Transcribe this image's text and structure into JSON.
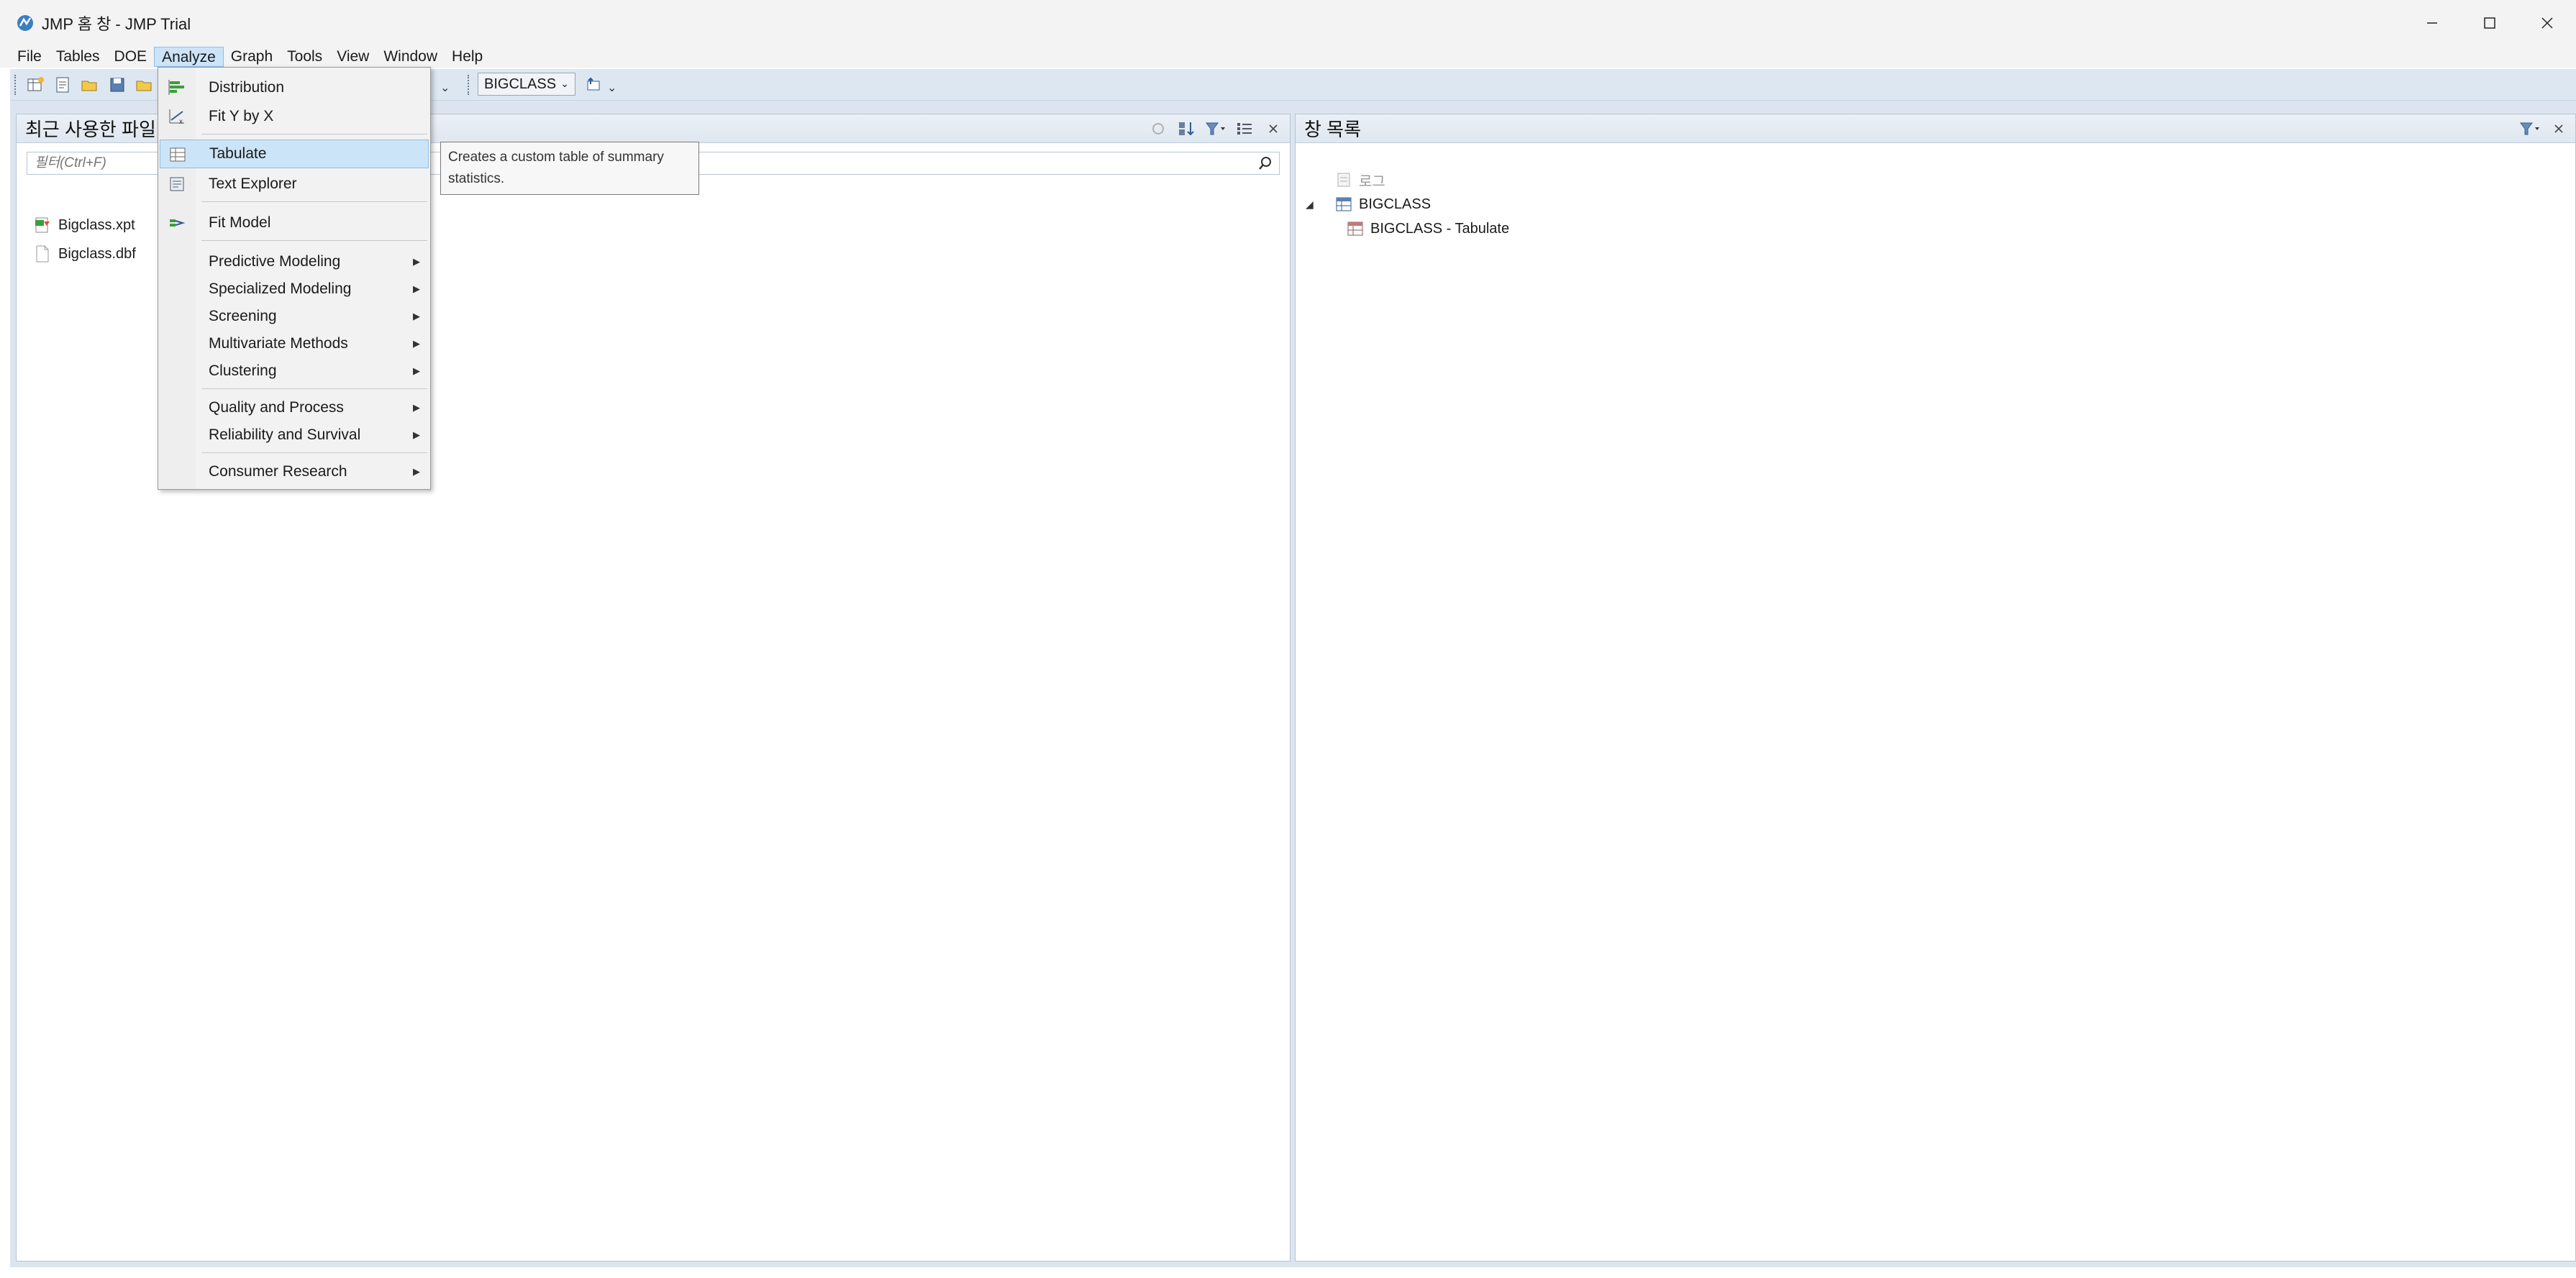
{
  "window": {
    "title": "JMP 홈 창 - JMP Trial",
    "controls": [
      "minimize-icon",
      "maximize-icon",
      "close-icon"
    ]
  },
  "menubar": {
    "items": [
      "File",
      "Tables",
      "DOE",
      "Analyze",
      "Graph",
      "Tools",
      "View",
      "Window",
      "Help"
    ],
    "active": "Analyze"
  },
  "toolbar": {
    "data_table_select": "BIGCLASS"
  },
  "analyze_menu": {
    "items": [
      {
        "label": "Distribution",
        "icon": "distribution-icon",
        "submenu": false
      },
      {
        "label": "Fit Y by X",
        "icon": "fit-y-by-x-icon",
        "submenu": false
      },
      {
        "label": "Tabulate",
        "icon": "tabulate-icon",
        "submenu": false,
        "highlighted": true
      },
      {
        "label": "Text Explorer",
        "icon": "text-explorer-icon",
        "submenu": false
      },
      {
        "label": "Fit Model",
        "icon": "fit-model-icon",
        "submenu": false
      },
      {
        "label": "Predictive Modeling",
        "submenu": true
      },
      {
        "label": "Specialized Modeling",
        "submenu": true
      },
      {
        "label": "Screening",
        "submenu": true
      },
      {
        "label": "Multivariate Methods",
        "submenu": true
      },
      {
        "label": "Clustering",
        "submenu": true
      },
      {
        "label": "Quality and Process",
        "submenu": true
      },
      {
        "label": "Reliability and Survival",
        "submenu": true
      },
      {
        "label": "Consumer Research",
        "submenu": true
      }
    ]
  },
  "tooltip": {
    "line1": "Creates a custom table of summary",
    "line2": "statistics."
  },
  "recent_files_panel": {
    "title": "최근 사용한 파일",
    "filter_placeholder": "필터(Ctrl+F)",
    "files": [
      {
        "name": "Bigclass.xpt",
        "icon": "sas-transport-file-icon"
      },
      {
        "name": "Bigclass.dbf",
        "icon": "blank-file-icon"
      }
    ]
  },
  "window_list_panel": {
    "title": "창 목록",
    "items": [
      {
        "label": "로그",
        "level": 0,
        "icon": "log-icon",
        "muted": true
      },
      {
        "label": "BIGCLASS",
        "level": 0,
        "icon": "data-table-icon",
        "expanded": true
      },
      {
        "label": "BIGCLASS - Tabulate",
        "level": 1,
        "icon": "report-icon"
      }
    ]
  },
  "colors": {
    "menu_highlight": "#cce4f7",
    "menu_highlight_border": "#8fbde6",
    "workspace_bg": "#dce5ef"
  }
}
